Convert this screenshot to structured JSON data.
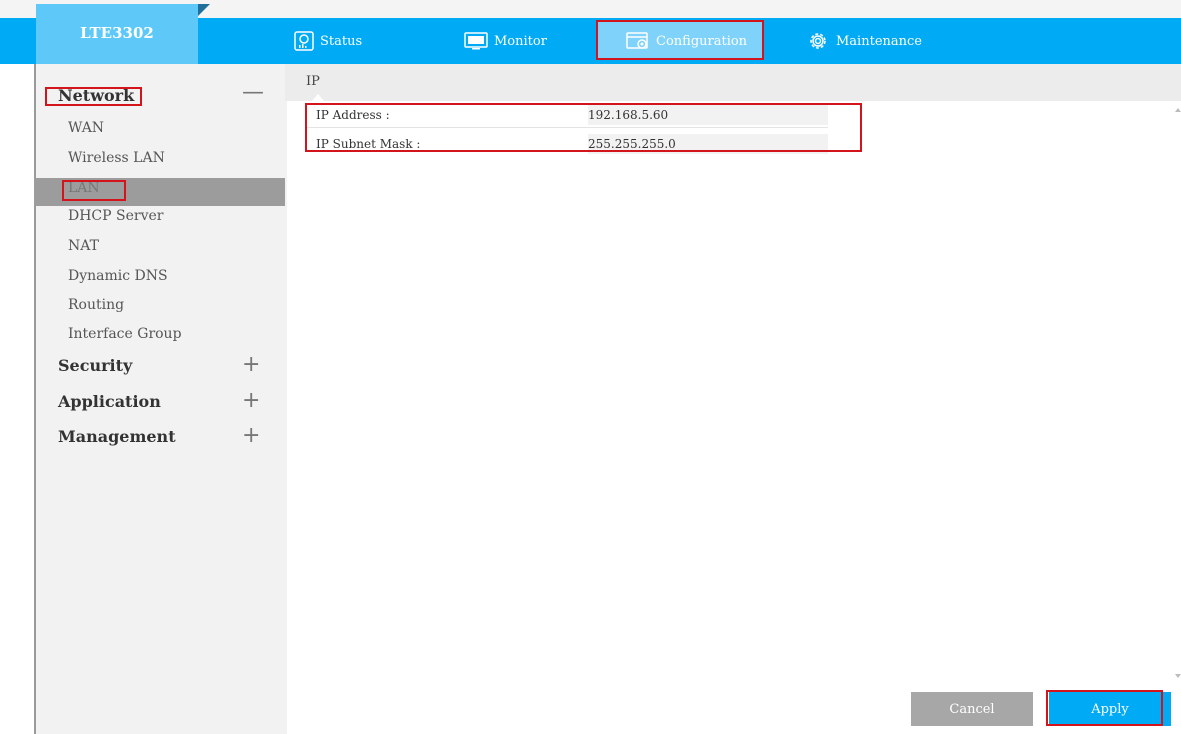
{
  "app": {
    "title": "LTE3302"
  },
  "nav": {
    "items": [
      {
        "label": "Status",
        "icon": "status-chart-icon"
      },
      {
        "label": "Monitor",
        "icon": "monitor-icon"
      },
      {
        "label": "Configuration",
        "icon": "configuration-icon",
        "active": true
      },
      {
        "label": "Maintenance",
        "icon": "gear-icon"
      }
    ]
  },
  "sidebar": {
    "network": {
      "label": "Network",
      "toggle": "—",
      "expanded": true
    },
    "network_items": [
      "WAN",
      "Wireless LAN",
      "LAN",
      "DHCP Server",
      "NAT",
      "Dynamic DNS",
      "Routing",
      "Interface Group"
    ],
    "selected": "LAN",
    "security": {
      "label": "Security",
      "toggle": "+"
    },
    "application": {
      "label": "Application",
      "toggle": "+"
    },
    "management": {
      "label": "Management",
      "toggle": "+"
    }
  },
  "main": {
    "section_title": "IP",
    "fields": [
      {
        "label": "IP Address :",
        "value": "192.168.5.60"
      },
      {
        "label": "IP Subnet Mask :",
        "value": "255.255.255.0"
      }
    ]
  },
  "buttons": {
    "cancel": "Cancel",
    "apply": "Apply"
  },
  "colors": {
    "accent": "#00aaf5",
    "highlight": "#d4141d",
    "selected": "#9c9c9c"
  }
}
